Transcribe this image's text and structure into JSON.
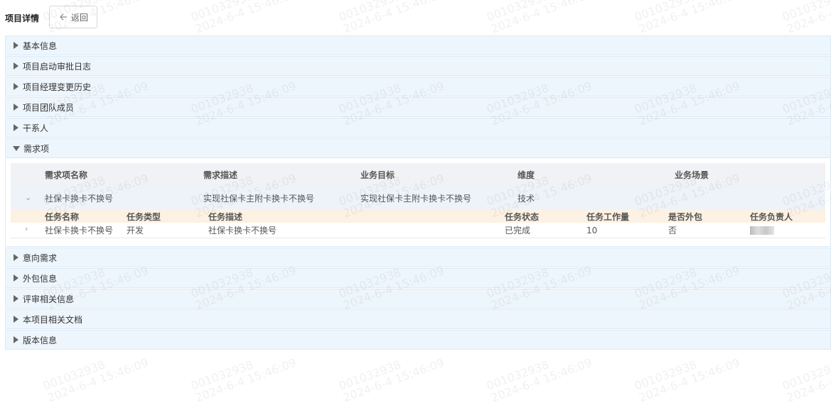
{
  "page": {
    "title": "项目详情",
    "back_label": "返回"
  },
  "panels_top": [
    {
      "label": "基本信息"
    },
    {
      "label": "项目启动审批日志"
    },
    {
      "label": "项目经理变更历史"
    },
    {
      "label": "项目团队成员"
    },
    {
      "label": "干系人"
    }
  ],
  "requirement_panel": {
    "label": "需求项",
    "columns": [
      "需求项名称",
      "需求描述",
      "业务目标",
      "维度",
      "业务场景"
    ],
    "rows": [
      {
        "name": "社保卡换卡不换号",
        "description": "实现社保卡主附卡换卡不换号",
        "goal": "实现社保卡主附卡换卡不换号",
        "dimension": "技术",
        "scenario": "",
        "task_columns": [
          "任务名称",
          "任务类型",
          "任务描述",
          "任务状态",
          "任务工作量",
          "是否外包",
          "任务负责人"
        ],
        "tasks": [
          {
            "name": "社保卡换卡不换号",
            "type": "开发",
            "description": "社保卡换卡不换号",
            "status": "已完成",
            "workload": "10",
            "outsourced": "否"
          }
        ]
      }
    ]
  },
  "panels_bottom": [
    {
      "label": "意向需求"
    },
    {
      "label": "外包信息"
    },
    {
      "label": "评审相关信息"
    },
    {
      "label": "本项目相关文档"
    },
    {
      "label": "版本信息"
    }
  ],
  "watermark": {
    "line1": "001032938",
    "line2": "2024-6-4 15:46:09"
  },
  "colors": {
    "panel_bg": "#eef6fd",
    "task_header_bg": "#fdf1e3",
    "row_bg": "#eef3f9"
  }
}
